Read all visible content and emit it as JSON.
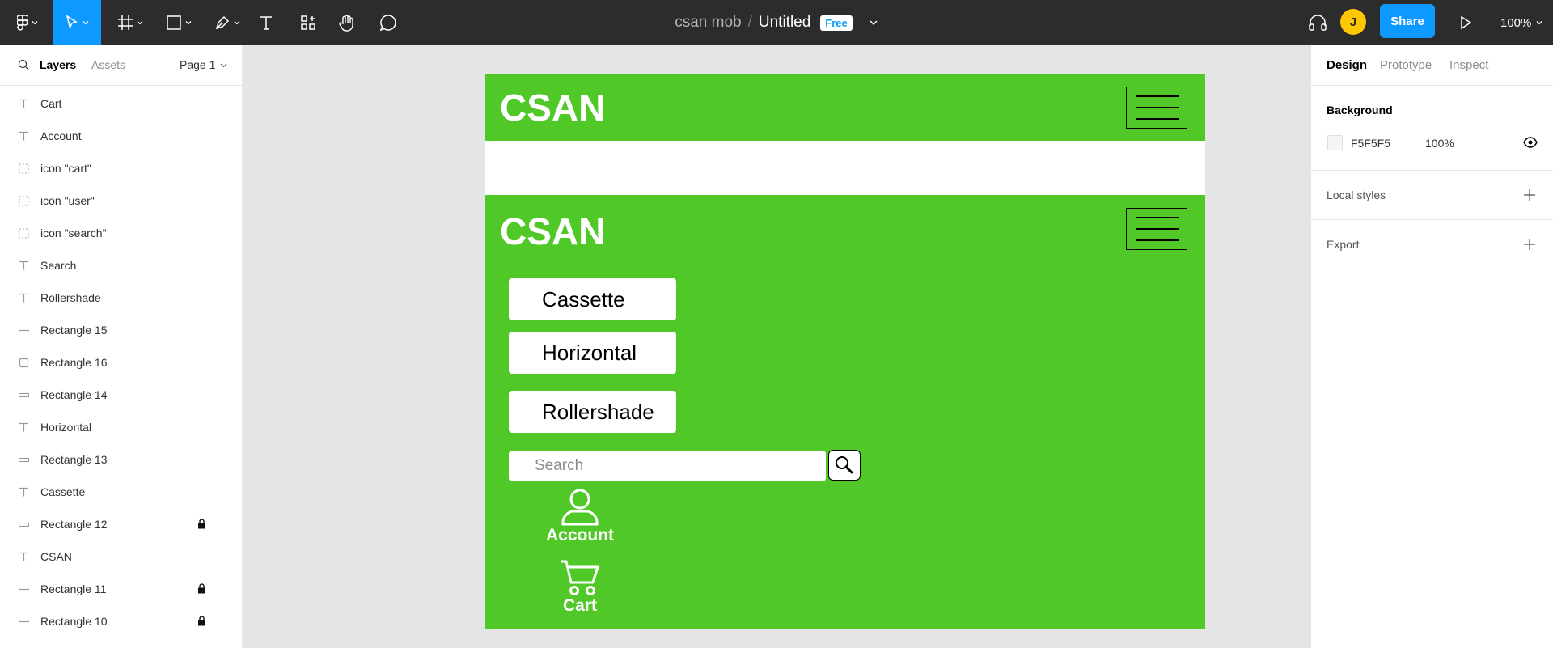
{
  "toolbar": {
    "project_name": "csan mob",
    "separator": "/",
    "file_name": "Untitled",
    "plan_badge": "Free",
    "avatar_initial": "J",
    "share_label": "Share",
    "zoom_level": "100%",
    "accent_color": "#0d99ff"
  },
  "left_panel": {
    "tabs": {
      "layers": "Layers",
      "assets": "Assets"
    },
    "page_selector": "Page 1",
    "layers": [
      {
        "name": "Cart",
        "icon": "text-icon",
        "locked": false
      },
      {
        "name": "Account",
        "icon": "text-icon",
        "locked": false
      },
      {
        "name": "icon \"cart\"",
        "icon": "component-icon",
        "locked": false
      },
      {
        "name": "icon \"user\"",
        "icon": "component-icon",
        "locked": false
      },
      {
        "name": "icon \"search\"",
        "icon": "component-icon",
        "locked": false
      },
      {
        "name": "Search",
        "icon": "text-icon",
        "locked": false
      },
      {
        "name": "Rollershade",
        "icon": "text-icon",
        "locked": false
      },
      {
        "name": "Rectangle 15",
        "icon": "line-icon",
        "locked": false
      },
      {
        "name": "Rectangle 16",
        "icon": "rectangle-icon",
        "locked": false
      },
      {
        "name": "Rectangle 14",
        "icon": "thin-rectangle-icon",
        "locked": false
      },
      {
        "name": "Horizontal",
        "icon": "text-icon",
        "locked": false
      },
      {
        "name": "Rectangle 13",
        "icon": "thin-rectangle-icon",
        "locked": false
      },
      {
        "name": "Cassette",
        "icon": "text-icon",
        "locked": false
      },
      {
        "name": "Rectangle 12",
        "icon": "thin-rectangle-icon",
        "locked": true
      },
      {
        "name": "CSAN",
        "icon": "text-icon",
        "locked": false
      },
      {
        "name": "Rectangle 11",
        "icon": "line-icon",
        "locked": true
      },
      {
        "name": "Rectangle 10",
        "icon": "line-icon",
        "locked": true
      }
    ]
  },
  "canvas": {
    "background": "#e5e5e5",
    "brand_green": "#4fc828",
    "header": {
      "logo": "CSAN"
    },
    "menu": {
      "logo": "CSAN",
      "items": [
        "Cassette",
        "Horizontal",
        "Rollershade"
      ],
      "search_placeholder": "Search",
      "account_label": "Account",
      "cart_label": "Cart"
    }
  },
  "right_panel": {
    "tabs": {
      "design": "Design",
      "prototype": "Prototype",
      "inspect": "Inspect"
    },
    "background_title": "Background",
    "background_hex": "F5F5F5",
    "background_opacity": "100%",
    "local_styles_title": "Local styles",
    "export_title": "Export"
  }
}
